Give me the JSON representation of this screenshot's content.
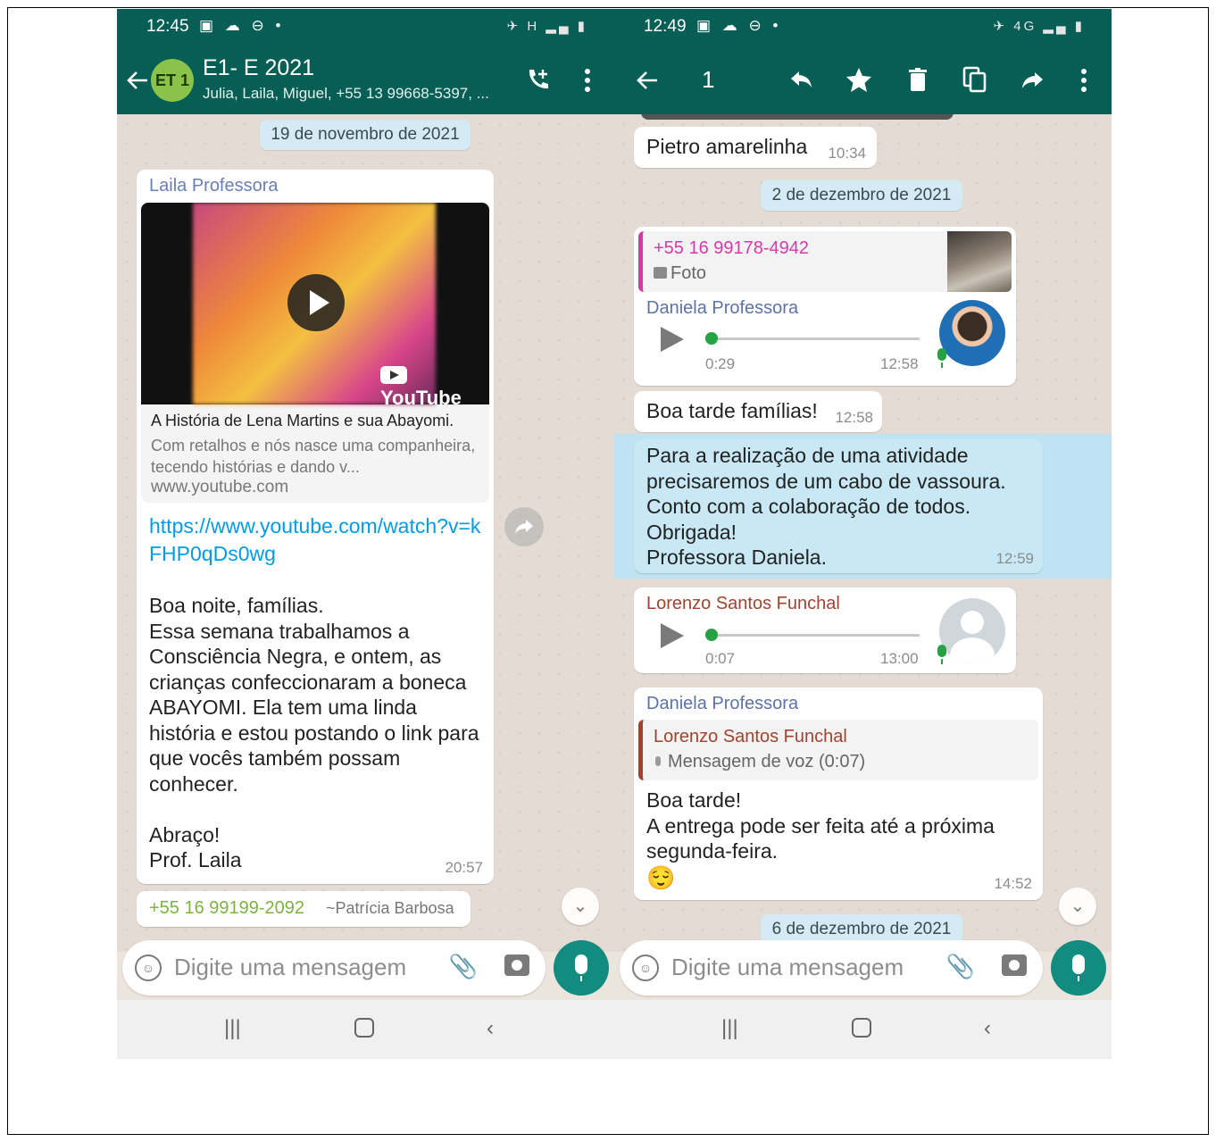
{
  "left": {
    "status": {
      "time": "12:45",
      "icons": "▣ ☁ ⊖ •",
      "right_icons": "✈ H ▂▄ ▮"
    },
    "header": {
      "avatar_text": "ET 1",
      "title": "E1- E 2021",
      "subtitle": "Julia, Laila, Miguel, +55 13 99668-5397, ..."
    },
    "date_pill": "19 de novembro de 2021",
    "message": {
      "sender": "Laila Professora",
      "preview_badge": "YouTube",
      "preview_title": "A História de Lena Martins e sua Abayomi.",
      "preview_desc": "Com retalhos e nós nasce uma companheira, tecendo histórias e dando v...",
      "preview_domain": "www.youtube.com",
      "link": "https://www.youtube.com/watch?v=kFHP0qDs0wg",
      "body": "Boa noite, famílias.\nEssa semana trabalhamos a Consciência Negra, e ontem, as crianças confeccionaram a boneca ABAYOMI. Ela tem uma linda história e estou postando o link para que vocês também possam conhecer.\n\nAbraço!\nProf. Laila",
      "time": "20:57"
    },
    "next_sender": {
      "phone": "+55 16 99199-2092",
      "name": "~Patrícia Barbosa"
    },
    "composer": {
      "placeholder": "Digite uma mensagem"
    }
  },
  "right": {
    "status": {
      "time": "12:49",
      "icons": "▣ ☁ ⊖ •",
      "right_icons": "✈ 4G ▂▄ ▮"
    },
    "header": {
      "selected_count": "1"
    },
    "msg_pietro": {
      "text": "Pietro amarelinha",
      "time": "10:34"
    },
    "date_pill_1": "2 de dezembro de 2021",
    "msg_audio_daniela": {
      "quote_phone": "+55 16 99178-4942",
      "quote_type": "Foto",
      "sender": "Daniela Professora",
      "duration": "0:29",
      "time": "12:58"
    },
    "msg_boa_tarde": {
      "text": "Boa tarde famílias!",
      "time": "12:58"
    },
    "msg_selected": {
      "text": "Para a realização de uma atividade\nprecisaremos de um cabo de vassoura.\nConto com a colaboração de todos.\nObrigada!\nProfessora Daniela.",
      "time": "12:59"
    },
    "msg_audio_lorenzo": {
      "sender": "Lorenzo Santos Funchal",
      "duration": "0:07",
      "time": "13:00"
    },
    "msg_reply": {
      "sender": "Daniela Professora",
      "quote_sender": "Lorenzo Santos Funchal",
      "quote_text": "Mensagem de voz (0:07)",
      "text": "Boa tarde!\nA entrega pode ser feita  até a próxima\nsegunda-feira.",
      "emoji": "😌",
      "time": "14:52"
    },
    "date_pill_2": "6 de dezembro de 2021",
    "composer": {
      "placeholder": "Digite uma mensagem"
    }
  },
  "colors": {
    "header": "#075e54",
    "accent": "#128c7e",
    "link": "#039be5",
    "selected": "#bfe3f2"
  }
}
